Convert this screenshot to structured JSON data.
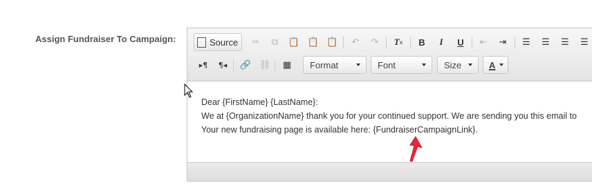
{
  "label": "Assign Fundraiser To Campaign:",
  "toolbar": {
    "row1": {
      "source_label": "Source",
      "icons": [
        "cut-icon",
        "copy-icon",
        "paste-icon",
        "paste-text-icon",
        "paste-word-icon",
        "undo-icon",
        "redo-icon",
        "remove-format-icon",
        "bold-icon",
        "italic-icon",
        "underline-icon",
        "outdent-icon",
        "indent-icon",
        "align-left-icon",
        "align-center-icon",
        "align-right-icon",
        "justify-icon"
      ],
      "bold": "B",
      "italic": "I",
      "underline": "U",
      "remove_format": "T"
    },
    "row2": {
      "ltr": "▸¶",
      "rtl": "¶◂",
      "format_label": "Format",
      "font_label": "Font",
      "size_label": "Size",
      "text_color": "A"
    }
  },
  "content": {
    "line1": "Dear {FirstName} {LastName}:",
    "line2": "We at {OrganizationName} thank you for your continued support. We are sending you this email to",
    "line3": "Your new fundraising page is available here: {FundraiserCampaignLink}."
  },
  "colors": {
    "annotation_arrow": "#e8273c",
    "toolbar_bg": "#e9e9e9"
  }
}
